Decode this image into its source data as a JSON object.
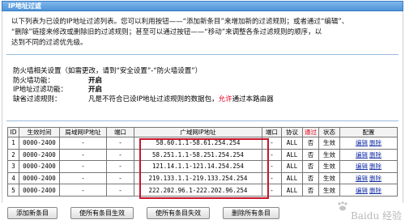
{
  "page_title": "IP地址过滤",
  "intro_lines": [
    "以下列表为已设的IP地址过滤列表。您可以利用按钮——“添加新条目”来增加新的过滤规则；或者通过“编辑”、",
    "“删除”链接来修改或删除旧的过滤规则；甚至可以通过按钮——“移动”来调整各条过滤规则的顺序，以",
    "达到不同的过滤优先级。"
  ],
  "firewall": {
    "header": "防火墙相关设置（如需更改，请到“安全设置”-“防火墙设置”）",
    "status_label": "防火墙功能：",
    "status_value": "开启",
    "ip_filter_label": "IP地址过滤功能：",
    "ip_filter_value": "开启",
    "default_rule_label": "缺省过滤规则：",
    "default_rule_pre": "凡是不符合已设IP地址过滤规则的数据包，",
    "default_rule_allow": "允许",
    "default_rule_post": "通过本路由器"
  },
  "table": {
    "headers": {
      "id": "ID",
      "time": "生效时间",
      "lan_ip": "局域网IP地址",
      "lan_port": "端口",
      "wan_ip": "广域网IP地址",
      "wan_port": "端口",
      "protocol": "协议",
      "pass": "通过",
      "status": "状态",
      "config": "配置"
    },
    "rows": [
      {
        "id": "1",
        "time": "0000-2400",
        "lan_ip": "-",
        "lan_port": "-",
        "wan_ip": "58.60.1.1-58.61.254.254",
        "wan_port": "-",
        "protocol": "ALL",
        "pass": "否",
        "status": "生效",
        "edit": "编辑",
        "delete": "删除"
      },
      {
        "id": "2",
        "time": "0000-2400",
        "lan_ip": "-",
        "lan_port": "-",
        "wan_ip": "58.251.1.1-58.251.254.254",
        "wan_port": "-",
        "protocol": "ALL",
        "pass": "否",
        "status": "生效",
        "edit": "编辑",
        "delete": "删除"
      },
      {
        "id": "3",
        "time": "0000-2400",
        "lan_ip": "-",
        "lan_port": "-",
        "wan_ip": "121.14.1.1-121.14.254.254",
        "wan_port": "-",
        "protocol": "ALL",
        "pass": "否",
        "status": "生效",
        "edit": "编辑",
        "delete": "删除"
      },
      {
        "id": "4",
        "time": "0000-2400",
        "lan_ip": "-",
        "lan_port": "-",
        "wan_ip": "219.133.1.1-219.133.254.254",
        "wan_port": "-",
        "protocol": "ALL",
        "pass": "否",
        "status": "生效",
        "edit": "编辑",
        "delete": "删除"
      },
      {
        "id": "5",
        "time": "0000-2400",
        "lan_ip": "-",
        "lan_port": "-",
        "wan_ip": "222.202.96.1-222.202.96.254",
        "wan_port": "-",
        "protocol": "ALL",
        "pass": "否",
        "status": "生效",
        "edit": "编辑",
        "delete": "删除"
      }
    ]
  },
  "buttons": {
    "add": "添加新条目",
    "enable_all": "使所有条目生效",
    "disable_all": "使所有条目失效",
    "delete_all": "删除所有条目"
  },
  "watermark": "Baidu 经验",
  "colors": {
    "title_bar": "#4f94d8",
    "accent_red": "#e0001b",
    "link_blue": "#1833a8",
    "highlight_box": "#c7172b"
  }
}
